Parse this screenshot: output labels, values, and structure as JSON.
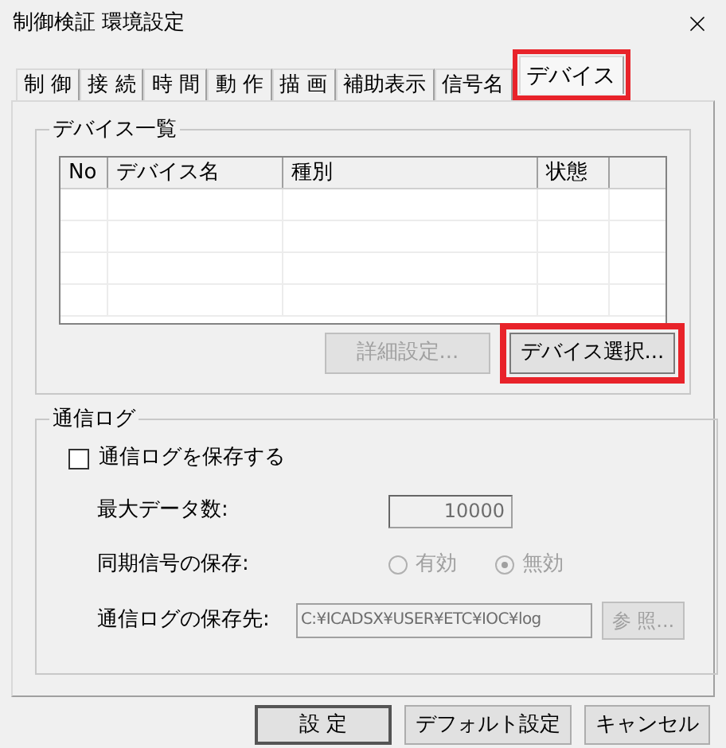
{
  "window": {
    "title": "制御検証 環境設定"
  },
  "tabs": [
    {
      "label": "制 御",
      "selected": false,
      "highlighted": false
    },
    {
      "label": "接 続",
      "selected": false,
      "highlighted": false
    },
    {
      "label": "時 間",
      "selected": false,
      "highlighted": false
    },
    {
      "label": "動 作",
      "selected": false,
      "highlighted": false
    },
    {
      "label": "描 画",
      "selected": false,
      "highlighted": false
    },
    {
      "label": "補助表示",
      "selected": false,
      "highlighted": false
    },
    {
      "label": "信号名",
      "selected": false,
      "highlighted": false
    },
    {
      "label": "デバイス",
      "selected": true,
      "highlighted": true
    }
  ],
  "device_list": {
    "title": "デバイス一覧",
    "table": {
      "columns": [
        "No",
        "デバイス名",
        "種別",
        "状態"
      ]
    },
    "buttons": [
      {
        "label": "詳細設定...",
        "disabled": true,
        "highlighted": false
      },
      {
        "label": "デバイス選択...",
        "disabled": false,
        "highlighted": true
      }
    ]
  },
  "comm_log": {
    "title": "通信ログ",
    "save_checkbox": {
      "label": "通信ログを保存する",
      "checked": false
    },
    "max_data": {
      "label": "最大データ数:",
      "value": "10000",
      "disabled": true
    },
    "sync_save": {
      "label": "同期信号の保存:",
      "options": [
        {
          "label": "有効",
          "selected": false,
          "disabled": true
        },
        {
          "label": "無効",
          "selected": true,
          "disabled": true
        }
      ]
    },
    "destination": {
      "label": "通信ログの保存先:",
      "value": "C:¥ICADSX¥USER¥ETC¥IOC¥log",
      "disabled": true,
      "button": {
        "label": "参 照...",
        "disabled": true
      }
    }
  },
  "footer_buttons": [
    {
      "label": "設 定",
      "default": true
    },
    {
      "label": "デフォルト設定",
      "default": false
    },
    {
      "label": "キャンセル",
      "default": false
    }
  ]
}
